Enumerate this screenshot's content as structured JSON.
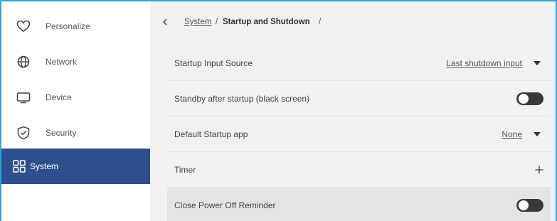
{
  "sidebar": {
    "items": [
      {
        "label": "Personalize",
        "icon": "heart-icon"
      },
      {
        "label": "Network",
        "icon": "globe-icon"
      },
      {
        "label": "Device",
        "icon": "monitor-icon"
      },
      {
        "label": "Security",
        "icon": "shield-check-icon"
      },
      {
        "label": "System",
        "icon": "grid-icon",
        "active": true
      }
    ],
    "active_color": "#2f4f8c"
  },
  "breadcrumb": {
    "back_icon": "chevron-left-icon",
    "link": "System",
    "separator": "/",
    "current": "Startup and Shutdown",
    "trailing": "/"
  },
  "settings": {
    "startup_input_source": {
      "label": "Startup Input Source",
      "value": "Last shutdown input"
    },
    "standby_after_startup": {
      "label": "Standby after startup (black screen)",
      "enabled": false
    },
    "default_startup_app": {
      "label": "Default Startup app",
      "value": "None"
    },
    "timer": {
      "label": "Timer",
      "action_icon": "plus-icon"
    },
    "close_power_off_reminder": {
      "label": "Close Power Off Reminder",
      "enabled": false
    }
  },
  "colors": {
    "frame_border": "#2aa6dc",
    "toggle_off": "#3a3a3a",
    "content_bg": "#f1f1f1"
  }
}
